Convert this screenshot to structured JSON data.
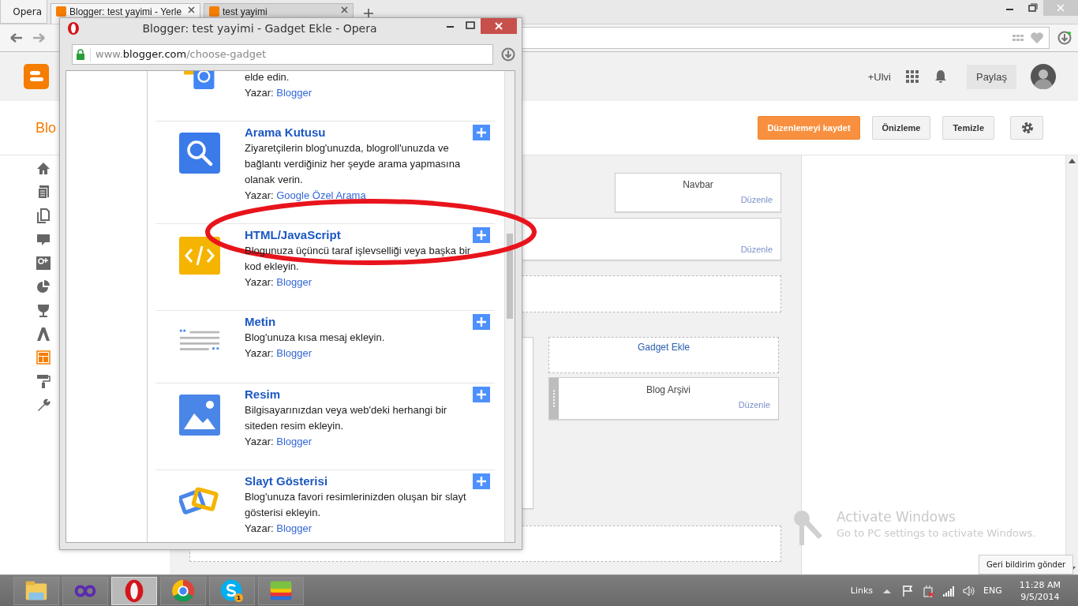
{
  "browser": {
    "menu_label": "Opera",
    "tabs": [
      {
        "title": "Blogger: test yayimi - Yerle",
        "selected": true
      },
      {
        "title": "test yayimi",
        "selected": false
      }
    ]
  },
  "blogger": {
    "account": "+Ulvi",
    "share_button": "Paylaş",
    "blog_title": "Blo",
    "actions": [
      {
        "label": "Düzenlemeyi kaydet",
        "kind": "primary"
      },
      {
        "label": "Önizleme",
        "kind": "normal"
      },
      {
        "label": "Temizle",
        "kind": "normal"
      },
      {
        "kind": "settings"
      }
    ],
    "sidebar_items": [
      {
        "kind": "home",
        "selected": false
      },
      {
        "kind": "posts",
        "selected": false
      },
      {
        "kind": "pages",
        "selected": false
      },
      {
        "kind": "comments",
        "selected": false
      },
      {
        "kind": "gplus",
        "selected": false
      },
      {
        "kind": "stats",
        "selected": false
      },
      {
        "kind": "earnings",
        "selected": false
      },
      {
        "kind": "campaigns",
        "selected": false
      },
      {
        "kind": "layout",
        "selected": true
      },
      {
        "kind": "template",
        "selected": false
      },
      {
        "kind": "settings",
        "selected": false
      }
    ]
  },
  "layout": {
    "navbar": {
      "title": "Navbar",
      "edit": "Düzenle"
    },
    "header": {
      "edit": "Düzenle"
    },
    "add_gadget": "Gadget Ekle",
    "archive": {
      "title": "Blog Arşivi",
      "edit": "Düzenle"
    }
  },
  "popup": {
    "title": "Blogger: test yayimi - Gadget Ekle - Opera",
    "url_parts": [
      {
        "text": "www.",
        "kind": "dim"
      },
      {
        "text": "blogger.com",
        "kind": "strong"
      },
      {
        "text": "/choose-gadget",
        "kind": "dim"
      }
    ],
    "gadgets": [
      {
        "kind": "money",
        "description": "elde edin.",
        "author_label": "Yazar:",
        "author": "Blogger"
      },
      {
        "kind": "search",
        "title": "Arama Kutusu",
        "description": "Ziyaretçilerin blog'unuzda, blogroll'unuzda ve bağlantı verdiğiniz her şeyde arama yapmasına olanak verin.",
        "author_label": "Yazar:",
        "author": "Google Özel Arama"
      },
      {
        "kind": "code",
        "title": "HTML/JavaScript",
        "description": "Blogunuza üçüncü taraf işlevselliği veya başka bir kod ekleyin.",
        "author_label": "Yazar:",
        "author": "Blogger"
      },
      {
        "kind": "text",
        "title": "Metin",
        "description": "Blog'unuza kısa mesaj ekleyin.",
        "author_label": "Yazar:",
        "author": "Blogger"
      },
      {
        "kind": "image",
        "title": "Resim",
        "description": "Bilgisayarınızdan veya web'deki herhangi bir siteden resim ekleyin.",
        "author_label": "Yazar:",
        "author": "Blogger"
      },
      {
        "kind": "slideshow",
        "title": "Slayt Gösterisi",
        "description": "Blog'unuza favori resimlerinizden oluşan bir slayt gösterisi ekleyin.",
        "author_label": "Yazar:",
        "author": "Blogger"
      }
    ]
  },
  "activation_notice": {
    "title": "Activate Windows",
    "message": "Go to PC settings to activate Windows."
  },
  "feedback_button": "Geri bildirim gönder",
  "taskbar": {
    "apps": [
      {
        "kind": "explorer",
        "selected": false
      },
      {
        "kind": "infinity",
        "selected": false
      },
      {
        "kind": "opera",
        "selected": true
      },
      {
        "kind": "chrome",
        "selected": false
      },
      {
        "kind": "skype",
        "selected": false,
        "badge": "1"
      },
      {
        "kind": "bluestacks",
        "selected": false
      }
    ],
    "links_label": "Links",
    "language": "ENG",
    "time": "11:28 AM",
    "date": "9/5/2014"
  }
}
